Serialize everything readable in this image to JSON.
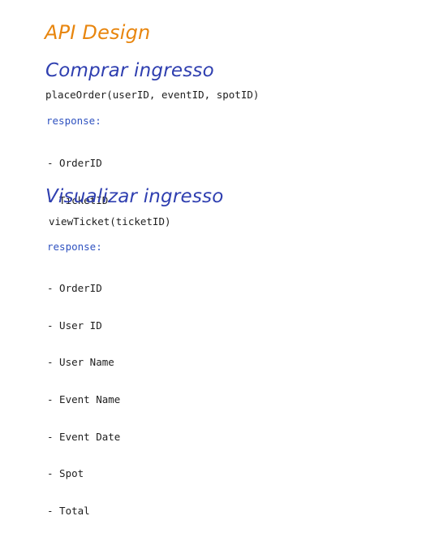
{
  "title": "API Design",
  "sections": [
    {
      "heading": "Comprar ingresso",
      "method": "placeOrder(userID, eventID, spotID)",
      "response_label": "response:",
      "fields": [
        "- OrderID",
        "- TicketID"
      ]
    },
    {
      "heading": "Visualizar ingresso",
      "method": "viewTicket(ticketID)",
      "response_label": "response:",
      "fields": [
        "- OrderID",
        "- User ID",
        "- User Name",
        "- Event Name",
        "- Event Date",
        "- Spot",
        "- Total"
      ]
    }
  ],
  "colors": {
    "title": "#e8860f",
    "heading": "#2f3fb0",
    "response_label": "#2f52c0",
    "text": "#1e1e1e"
  }
}
